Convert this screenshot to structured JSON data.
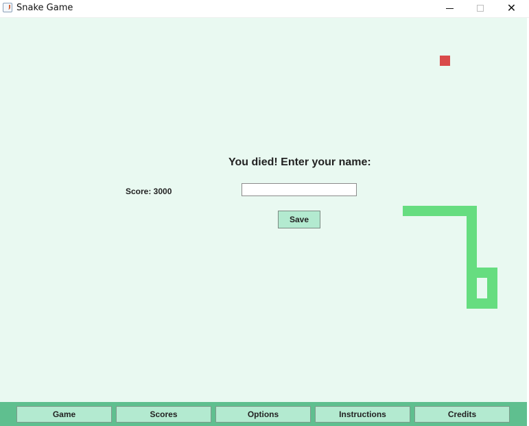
{
  "window": {
    "title": "Snake Game",
    "minimize_icon": "minimize-icon",
    "maximize_icon": "maximize-icon",
    "close_icon": "close-icon",
    "close_glyph": "✕"
  },
  "game": {
    "death_message": "You died! Enter your name:",
    "score_text": "Score: 3000",
    "name_input_value": "",
    "save_label": "Save",
    "colors": {
      "background": "#e9f9f1",
      "snake": "#66dd80",
      "food": "#d94a4a",
      "button": "#b3ead0",
      "bottom_bar": "#5fbf8f"
    }
  },
  "nav": {
    "items": [
      {
        "label": "Game"
      },
      {
        "label": "Scores"
      },
      {
        "label": "Options"
      },
      {
        "label": "Instructions"
      },
      {
        "label": "Credits"
      }
    ]
  }
}
